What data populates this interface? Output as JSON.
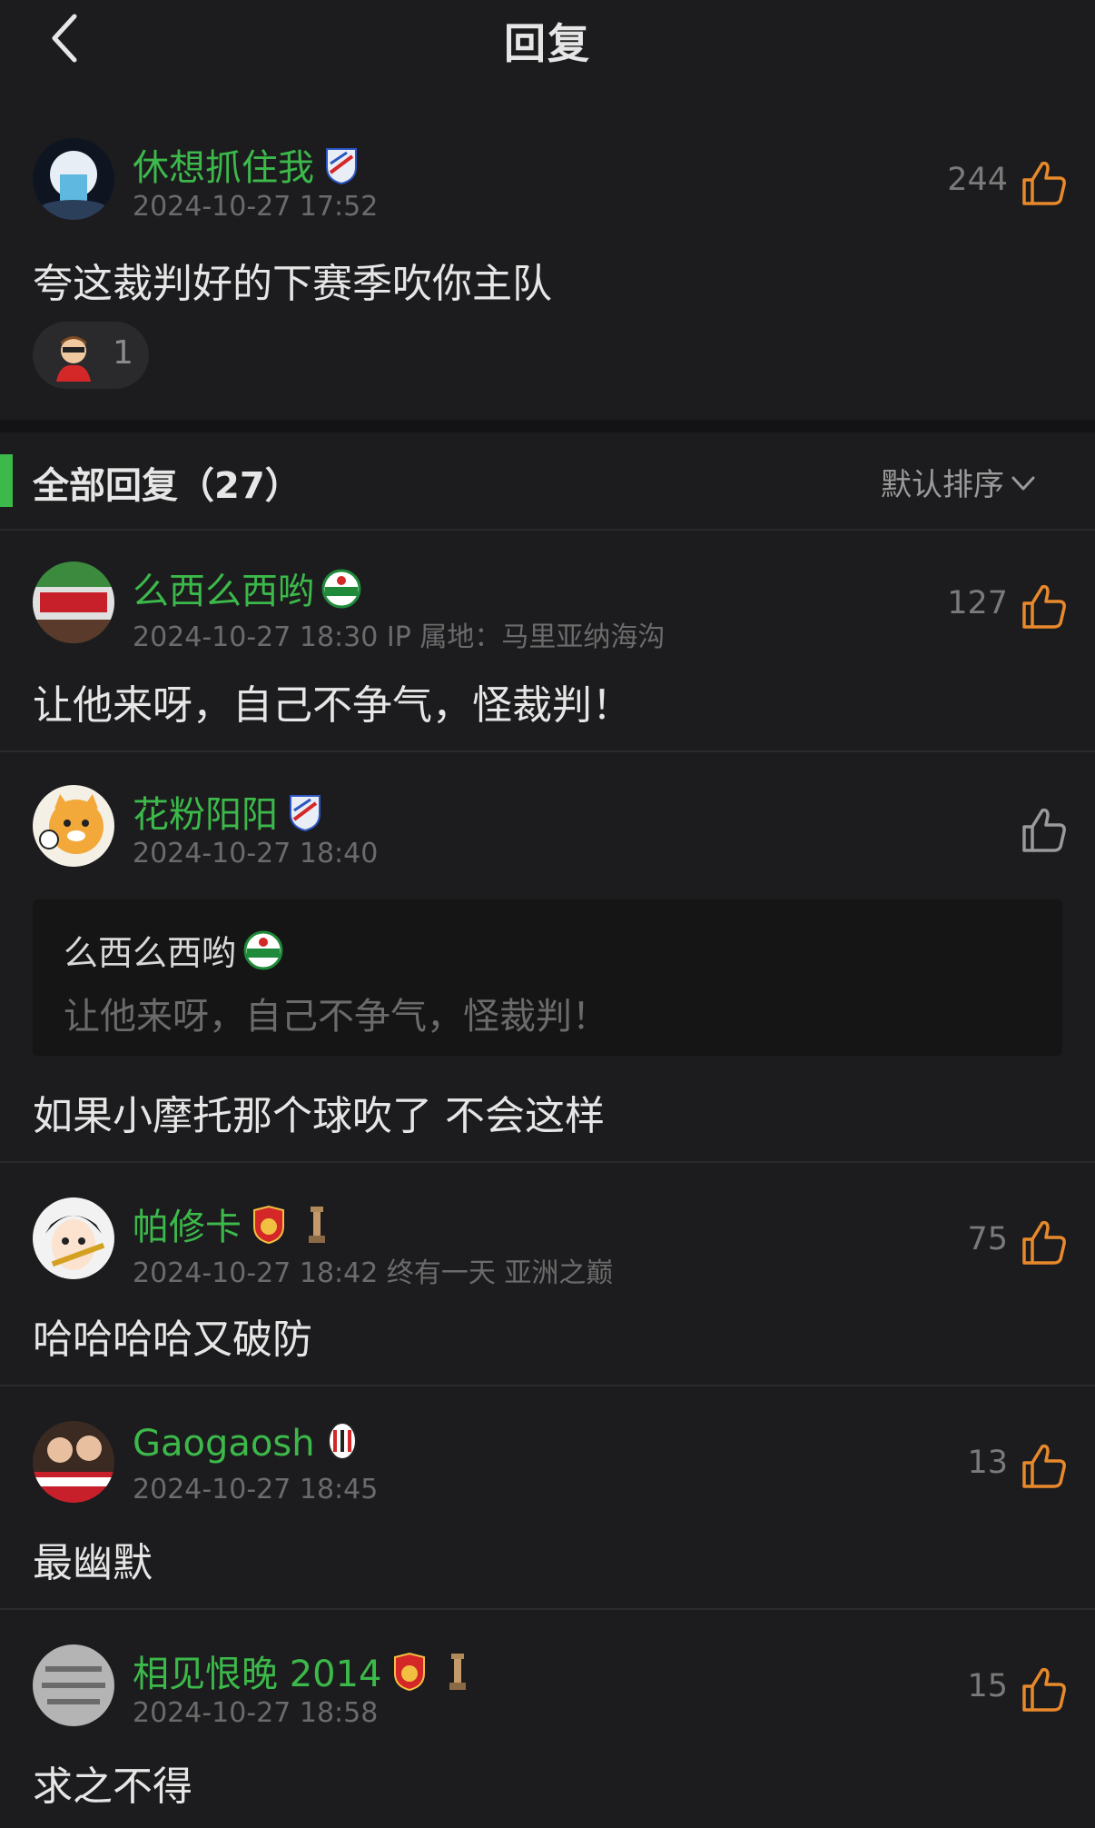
{
  "header": {
    "title": "回复"
  },
  "main_comment": {
    "username": "休想抓住我",
    "timestamp": "2024-10-27 17:52",
    "likes": "244",
    "text": "夸这裁判好的下赛季吹你主队",
    "reaction_count": "1"
  },
  "replies_section": {
    "title": "全部回复（27）",
    "sort_label": "默认排序"
  },
  "replies": [
    {
      "username": "么西么西哟",
      "timestamp": "2024-10-27 18:30 IP 属地：马里亚纳海沟",
      "likes": "127",
      "text": "让他来呀，自己不争气，怪裁判！"
    },
    {
      "username": "花粉阳阳",
      "timestamp": "2024-10-27 18:40",
      "likes": "",
      "text": "如果小摩托那个球吹了 不会这样",
      "quote": {
        "username": "么西么西哟",
        "text": "让他来呀，自己不争气，怪裁判！"
      }
    },
    {
      "username": "帕修卡",
      "timestamp": "2024-10-27 18:42 终有一天 亚洲之巅",
      "likes": "75",
      "text": "哈哈哈哈又破防"
    },
    {
      "username": "Gaogaosh",
      "timestamp": "2024-10-27 18:45",
      "likes": "13",
      "text": "最幽默"
    },
    {
      "username": "相见恨晚 2014",
      "timestamp": "2024-10-27 18:58",
      "likes": "15",
      "text": "求之不得"
    }
  ],
  "colors": {
    "accent_green": "#3cb94a",
    "like_orange": "#e8892c",
    "background": "#1c1c1e"
  }
}
